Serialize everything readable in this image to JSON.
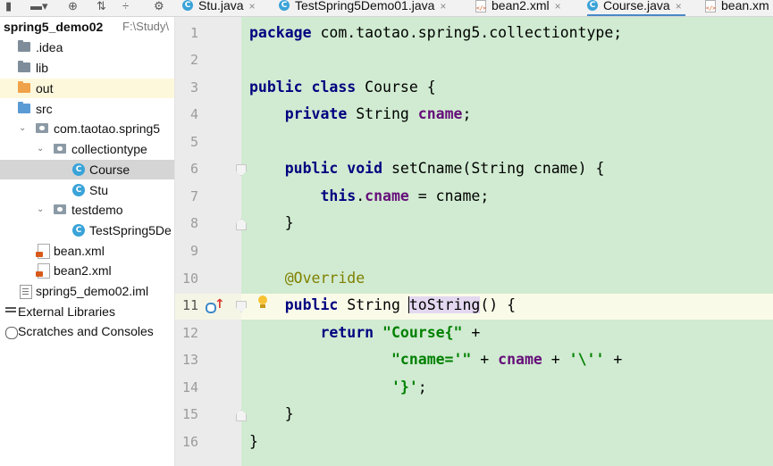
{
  "toolbar": {
    "items": [
      "dropdown-icon",
      "crosshair-icon",
      "collapse-all-icon",
      "expand-icon",
      "settings-icon"
    ]
  },
  "tabs": [
    {
      "label": "Stu.java",
      "type": "java"
    },
    {
      "label": "TestSpring5Demo01.java",
      "type": "java"
    },
    {
      "label": "bean2.xml",
      "type": "xml"
    },
    {
      "label": "Course.java",
      "type": "java",
      "active": true
    },
    {
      "label": "bean.xm",
      "type": "xml"
    }
  ],
  "tab_close_symbol": "×",
  "project": {
    "name": "spring5_demo02",
    "path": "F:\\Study\\",
    "nodes": [
      {
        "label": ".idea"
      },
      {
        "label": "lib"
      },
      {
        "label": "out"
      },
      {
        "label": "src"
      },
      {
        "label": "com.taotao.spring5"
      },
      {
        "label": "collectiontype"
      },
      {
        "label": "Course"
      },
      {
        "label": "Stu"
      },
      {
        "label": "testdemo"
      },
      {
        "label": "TestSpring5De"
      },
      {
        "label": "bean.xml"
      },
      {
        "label": "bean2.xml"
      },
      {
        "label": "spring5_demo02.iml"
      },
      {
        "label": "External Libraries"
      },
      {
        "label": "Scratches and Consoles"
      }
    ]
  },
  "editor": {
    "line_numbers": [
      "1",
      "2",
      "3",
      "4",
      "5",
      "6",
      "7",
      "8",
      "9",
      "10",
      "11",
      "12",
      "13",
      "14",
      "15",
      "16"
    ],
    "current_line": 11,
    "lines": [
      [
        "package",
        " com.taotao.spring5.collectiontype;"
      ],
      [
        ""
      ],
      [
        "public class",
        " Course {"
      ],
      [
        "    ",
        "private",
        " String ",
        "cname",
        ";"
      ],
      [
        ""
      ],
      [
        "    ",
        "public void",
        " setCname(String cname) {"
      ],
      [
        "        ",
        "this",
        ".",
        "cname",
        " = cname;"
      ],
      [
        "    }"
      ],
      [
        ""
      ],
      [
        "    ",
        "@Override"
      ],
      [
        "    ",
        "public",
        " String ",
        "toString",
        "() {"
      ],
      [
        "        ",
        "return",
        " ",
        "\"Course{\"",
        " +"
      ],
      [
        "                ",
        "\"cname='\"",
        " + ",
        "cname",
        " + ",
        "'\\''",
        " +"
      ],
      [
        "                ",
        "'}'",
        ";"
      ],
      [
        "    }"
      ],
      [
        "}"
      ]
    ]
  }
}
